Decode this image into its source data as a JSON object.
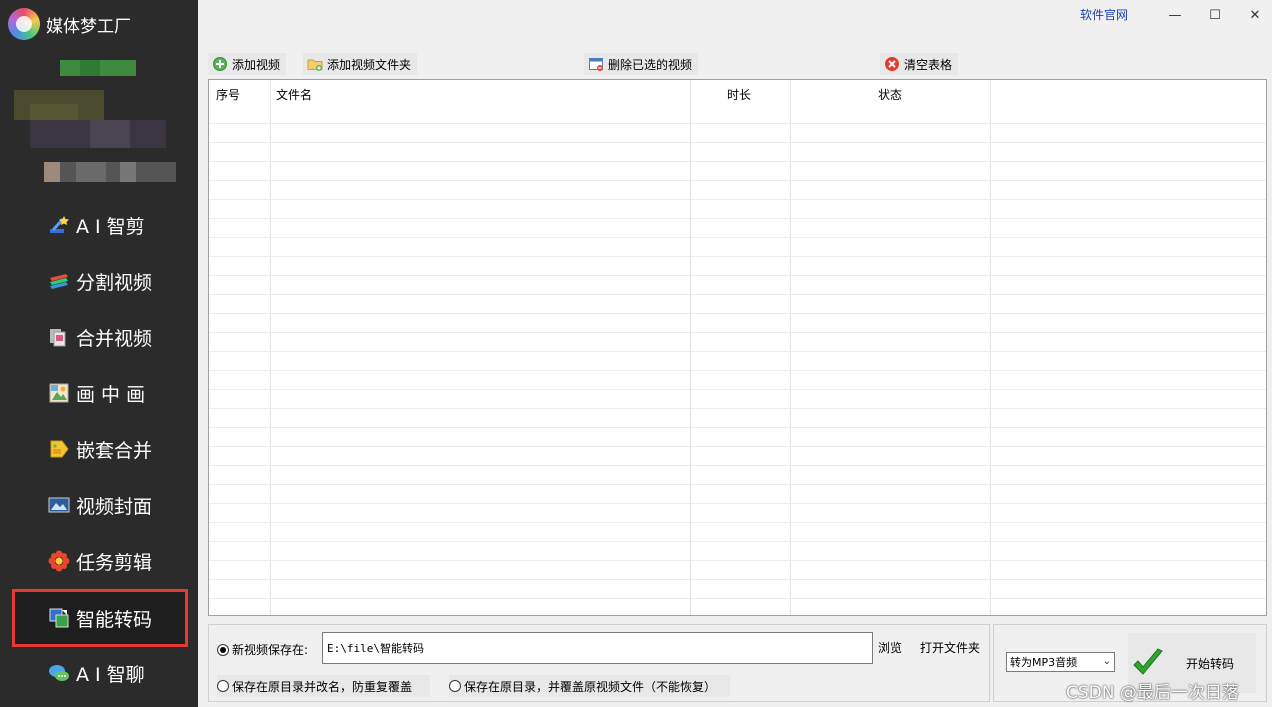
{
  "app": {
    "title": "媒体梦工厂"
  },
  "sidebar": {
    "items": [
      {
        "label": "A I 智剪",
        "icon": "magic-wand-icon"
      },
      {
        "label": "分割视频",
        "icon": "split-layers-icon"
      },
      {
        "label": "合并视频",
        "icon": "merge-pages-icon"
      },
      {
        "label": "画 中 画",
        "icon": "picture-in-picture-icon"
      },
      {
        "label": "嵌套合并",
        "icon": "nested-tag-icon"
      },
      {
        "label": "视频封面",
        "icon": "video-cover-icon"
      },
      {
        "label": "任务剪辑",
        "icon": "flower-task-icon"
      },
      {
        "label": "智能转码",
        "icon": "transcode-icon",
        "active": true
      },
      {
        "label": "A I 智聊",
        "icon": "chat-bubbles-icon"
      }
    ]
  },
  "titlebar": {
    "site_link": "软件官网",
    "minimize": "—",
    "maximize": "☐",
    "close": "✕"
  },
  "toolbar": {
    "add_video": "添加视频",
    "add_folder": "添加视频文件夹",
    "delete_selected": "删除已选的视频",
    "clear_table": "清空表格"
  },
  "table": {
    "columns": [
      "序号",
      "文件名",
      "时长",
      "状态"
    ],
    "rows": []
  },
  "save": {
    "new_location_label": "新视频保存在:",
    "path_value": "E:\\file\\智能转码",
    "browse": "浏览",
    "open_folder": "打开文件夹",
    "keep_rename": "保存在原目录并改名，防重复覆盖",
    "keep_overwrite": "保存在原目录，并覆盖原视频文件（不能恢复）",
    "selected": "new_location"
  },
  "convert": {
    "format_selected": "转为MP3音频",
    "start_label": "开始转码"
  },
  "watermark": "CSDN @最后一次日落",
  "colors": {
    "sidebar_bg": "#2b2b2b",
    "active_border": "#e53935",
    "link": "#1a3fb0"
  }
}
